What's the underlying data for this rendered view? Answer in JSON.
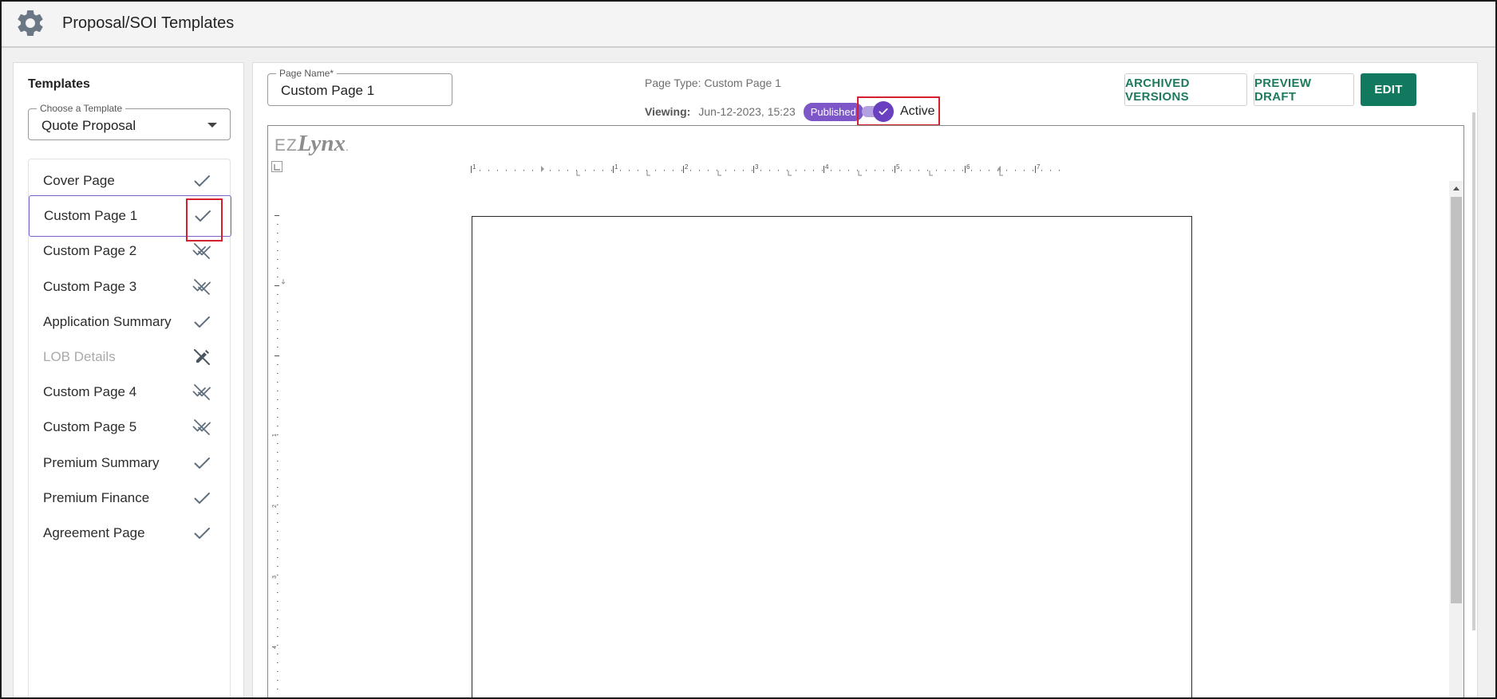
{
  "header": {
    "title": "Proposal/SOI Templates",
    "icon": "gear-icon"
  },
  "sidebar": {
    "heading": "Templates",
    "template_select": {
      "label": "Choose a Template",
      "value": "Quote Proposal"
    },
    "pages": [
      {
        "label": "Cover Page",
        "status": "check"
      },
      {
        "label": "Custom Page 1",
        "status": "check",
        "selected": true
      },
      {
        "label": "Custom Page 2",
        "status": "inactive"
      },
      {
        "label": "Custom Page 3",
        "status": "inactive"
      },
      {
        "label": "Application Summary",
        "status": "check"
      },
      {
        "label": "LOB Details",
        "status": "no-edit",
        "disabled": true
      },
      {
        "label": "Custom Page 4",
        "status": "inactive"
      },
      {
        "label": "Custom Page 5",
        "status": "inactive"
      },
      {
        "label": "Premium Summary",
        "status": "check"
      },
      {
        "label": "Premium Finance",
        "status": "check"
      },
      {
        "label": "Agreement Page",
        "status": "check"
      }
    ]
  },
  "main": {
    "page_name": {
      "label": "Page Name*",
      "value": "Custom Page 1"
    },
    "page_type": "Page Type: Custom Page 1",
    "viewing_label": "Viewing:",
    "viewing_date": "Jun-12-2023, 15:23",
    "badge": "Published",
    "active_toggle": {
      "label": "Active",
      "on": true
    },
    "buttons": {
      "archived": "ARCHIVED VERSIONS",
      "preview": "PREVIEW DRAFT",
      "edit": "EDIT"
    }
  },
  "editor": {
    "brand_ez": "EZ",
    "brand_lynx": "Lynx",
    "ruler_numbers": [
      "1",
      "1",
      "2",
      "3",
      "4",
      "5",
      "6",
      "7"
    ],
    "vruler_numbers": [
      "1",
      "2",
      "3",
      "4"
    ]
  },
  "colors": {
    "accent_purple": "#7d57c8",
    "primary_green": "#117a5e",
    "highlight_red": "#d4202f",
    "icon_gray": "#5f6f7e"
  }
}
